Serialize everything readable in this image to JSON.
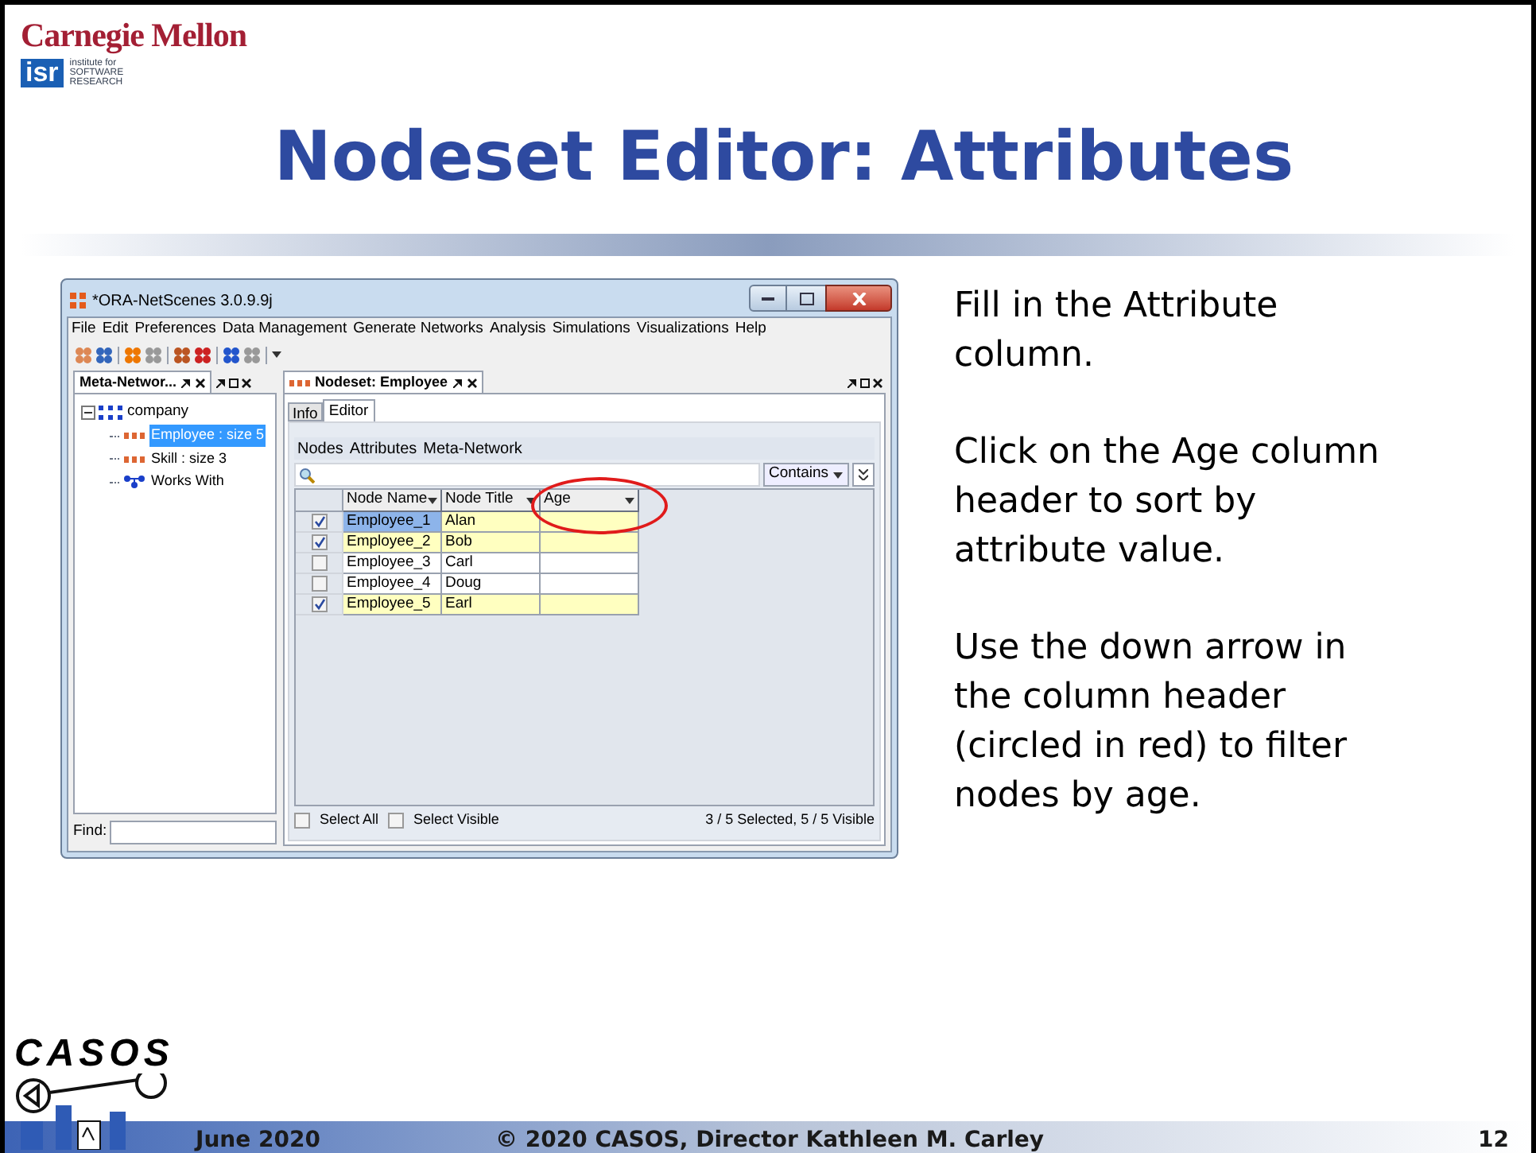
{
  "header": {
    "university": "Carnegie Mellon",
    "isr_mark": "isr",
    "isr_caption": [
      "institute for",
      "SOFTWARE",
      "RESEARCH"
    ]
  },
  "title": "Nodeset Editor: Attributes",
  "app_window": {
    "title": "*ORA-NetScenes 3.0.9.9j",
    "menu": [
      "File",
      "Edit",
      "Preferences",
      "Data Management",
      "Generate Networks",
      "Analysis",
      "Simulations",
      "Visualizations",
      "Help"
    ],
    "left_panel": {
      "tab": "Meta-Networ...",
      "tree": [
        {
          "label": "company",
          "expanded": true,
          "children": [
            {
              "label": "Employee : size 5",
              "kind": "nodeset",
              "selected": true
            },
            {
              "label": "Skill : size 3",
              "kind": "nodeset",
              "selected": false
            },
            {
              "label": "Works With",
              "kind": "network",
              "selected": false
            }
          ]
        }
      ],
      "find_label": "Find:"
    },
    "editor": {
      "tab": "Nodeset: Employee",
      "subtabs": [
        {
          "label": "Info",
          "selected": false
        },
        {
          "label": "Editor",
          "selected": true
        }
      ],
      "sections": [
        "Nodes",
        "Attributes",
        "Meta-Network"
      ],
      "filter_mode": "Contains",
      "columns": [
        "Node Name",
        "Node Title",
        "Age"
      ],
      "rows": [
        {
          "checked": true,
          "selected": true,
          "name": "Employee_1",
          "title": "Alan"
        },
        {
          "checked": true,
          "selected": false,
          "name": "Employee_2",
          "title": "Bob"
        },
        {
          "checked": false,
          "selected": false,
          "name": "Employee_3",
          "title": "Carl"
        },
        {
          "checked": false,
          "selected": false,
          "name": "Employee_4",
          "title": "Doug"
        },
        {
          "checked": true,
          "selected": false,
          "name": "Employee_5",
          "title": "Earl"
        }
      ],
      "select_all": {
        "label": "Select All",
        "checked": false
      },
      "select_visible": {
        "label": "Select Visible",
        "checked": false
      },
      "status": "3 / 5 Selected, 5 / 5 Visible"
    }
  },
  "instructions": [
    "Fill in the Attribute column.",
    "Click on the Age column header to sort by attribute value.",
    "Use the down arrow in the column header (circled in red) to filter nodes by age."
  ],
  "footer": {
    "logo": "CASOS",
    "date": "June 2020",
    "copyright": "© 2020 CASOS, Director Kathleen M. Carley",
    "page": "12"
  }
}
